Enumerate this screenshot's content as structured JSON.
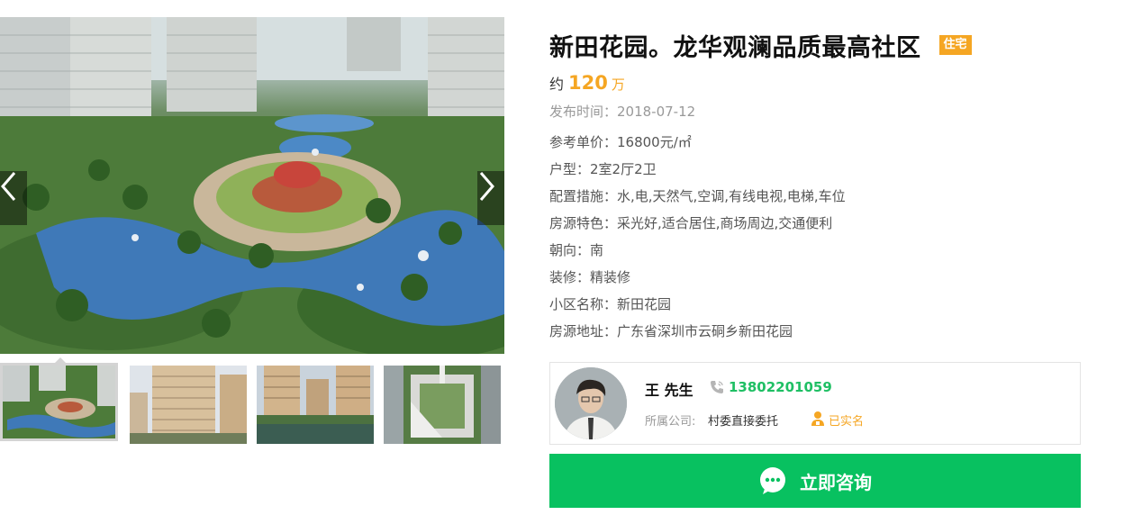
{
  "gallery": {
    "prev_icon": "chevron-left-icon",
    "next_icon": "chevron-right-icon",
    "thumbnails": [
      {
        "scene": "aerial garden plaza",
        "active": true
      },
      {
        "scene": "residential towers",
        "active": false
      },
      {
        "scene": "towers over pond",
        "active": false
      },
      {
        "scene": "aerial courtyard",
        "active": false
      }
    ]
  },
  "listing": {
    "title": "新田花园。龙华观澜品质最高社区",
    "type_badge": "住宅",
    "price_prefix": "约",
    "price_value": "120",
    "price_unit": "万",
    "publish_time": "发布时间：2018-07-12",
    "attributes": [
      "参考单价：16800元/㎡",
      "户型：2室2厅2卫",
      "配置措施：水,电,天然气,空调,有线电视,电梯,车位",
      "房源特色：采光好,适合居住,商场周边,交通便利",
      "朝向：南",
      "装修：精装修",
      "小区名称：新田花园",
      "房源地址：广东省深圳市云硐乡新田花园"
    ]
  },
  "agent": {
    "name": "王 先生",
    "phone": "13802201059",
    "company_label": "所属公司:",
    "company": "村委直接委托",
    "verified": "已实名"
  },
  "consult_button": {
    "label": "立即咨询",
    "icon": "chat-bubble-icon"
  },
  "colors": {
    "accent_orange": "#f5a623",
    "phone_green": "#1fbf64",
    "button_green": "#08c160"
  }
}
